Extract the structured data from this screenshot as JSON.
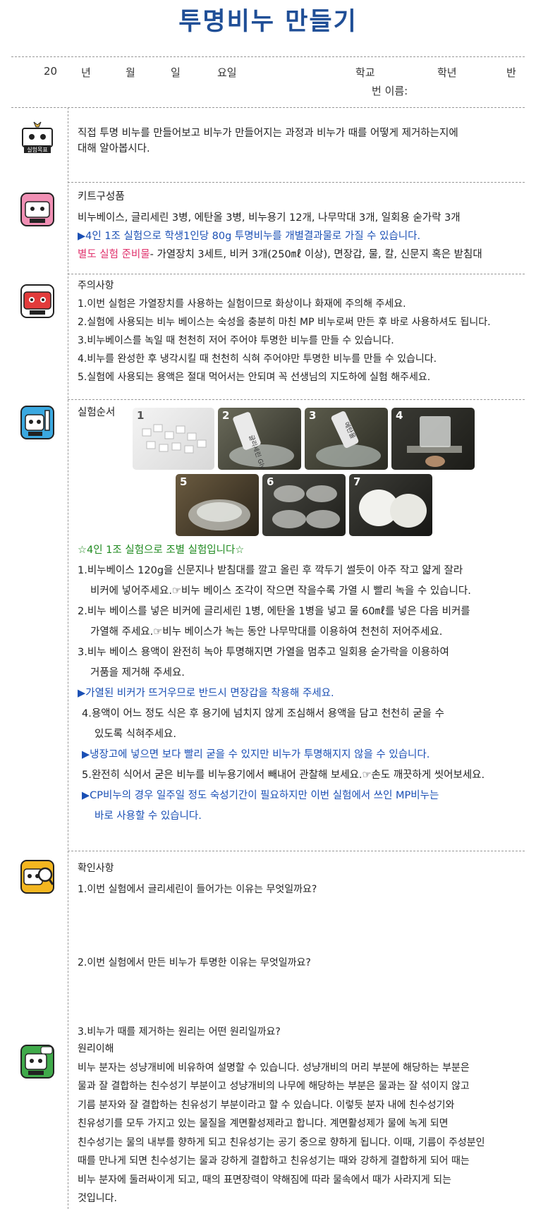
{
  "title": "투명비누 만들기",
  "header": {
    "date": [
      "20",
      "년",
      "월",
      "일",
      "요일"
    ],
    "school": [
      "학교",
      "학년",
      "반"
    ],
    "name": "번 이름:"
  },
  "icons": {
    "goal": "실험목표",
    "kit": "kit-icon",
    "caution": "caution-icon",
    "procedure": "procedure-icon",
    "check": "check-icon",
    "principle": "principle-icon"
  },
  "goal": {
    "text": "직접 투명 비누를 만들어보고 비누가 만들어지는 과정과 비누가 때를 어떻게 제거하는지에",
    "text2": "대해 알아봅시다."
  },
  "kit": {
    "heading": "키트구성품",
    "items": "비누베이스, 글리세린 3병, 에탄올 3병, 비누용기 12개, 나무막대 3개, 일회용 숟가락 3개",
    "note": "▶4인 1조 실험으로 학생1인당 80g 투명비누를 개별결과물로 가질 수 있습니다.",
    "extra_label": "별도 실험 준비물",
    "extra_text": "- 가열장치 3세트, 비커 3개(250㎖ 이상), 면장갑, 물, 칼, 신문지 혹은 받침대"
  },
  "caution": {
    "heading": "주의사항",
    "items": [
      "1.이번 실험은 가열장치를 사용하는 실험이므로 화상이나 화재에 주의해 주세요.",
      "2.실험에 사용되는 비누 베이스는 숙성을 충분히 마친 MP 비누로써 만든 후 바로 사용하셔도 됩니다.",
      "3.비누베이스를 녹일 때 천천히 저어 주어야 투명한 비누를 만들 수 있습니다.",
      "4.비누를 완성한 후 냉각시킬 때 천천히 식혀 주어야만 투명한 비누를 만들 수 있습니다.",
      "5.실험에 사용되는 용액은 절대 먹어서는 안되며 꼭 선생님의 지도하에 실험 해주세요."
    ]
  },
  "procedure": {
    "heading": "실험순서",
    "photo_labels": [
      "1",
      "2",
      "3",
      "4",
      "5",
      "6",
      "7"
    ],
    "photo_text_2": "글리세린 Glycerin",
    "photo_text_3": "에탄올",
    "group_note": "☆4인 1조 실험으로 조별 실험입니다☆",
    "steps": [
      "1.비누베이스 120g을 신문지나 받침대를 깔고 올린 후 깍두기 썰듯이 아주 작고 얇게 잘라",
      "비커에 넣어주세요.☞비누 베이스 조각이 작으면 작을수록 가열 시 빨리 녹을 수 있습니다.",
      "2.비누 베이스를 넣은 비커에 글리세린 1병, 에탄올 1병을 넣고 물 60㎖를 넣은 다음 비커를",
      "가열해 주세요.☞비누 베이스가 녹는 동안 나무막대를 이용하여 천천히 저어주세요.",
      "3.비누 베이스 용액이 완전히 녹아 투명해지면 가열을 멈추고 일회용 숟가락을 이용하여",
      "거품을 제거해 주세요."
    ],
    "warn1": "▶가열된 비커가 뜨거우므로 반드시 면장갑을 착용해 주세요.",
    "steps2": [
      "4.용액이 어느 정도 식은 후 용기에 넘치지 않게 조심해서 용액을 담고 천천히 굳을 수",
      "있도록 식혀주세요."
    ],
    "warn2": "▶냉장고에 넣으면 보다 빨리 굳을 수 있지만 비누가 투명해지지 않을 수 있습니다.",
    "step5": "5.완전히 식어서 굳은 비누를 비누용기에서 빼내어 관찰해 보세요.☞손도 깨끗하게 씻어보세요.",
    "warn3a": "▶CP비누의 경우 일주일 정도 숙성기간이 필요하지만 이번 실험에서 쓰인 MP비누는",
    "warn3b": "바로 사용할 수 있습니다."
  },
  "check": {
    "heading": "확인사항",
    "q1": "1.이번 실험에서 글리세린이 들어가는 이유는 무엇일까요?",
    "q2": "2.이번 실험에서 만든 비누가 투명한 이유는 무엇일까요?",
    "q3": "3.비누가 때를 제거하는 원리는 어떤 원리일까요?"
  },
  "principle": {
    "heading": "원리이해",
    "lines": [
      "비누 분자는 성냥개비에 비유하여 설명할 수 있습니다. 성냥개비의 머리 부분에 해당하는 부분은",
      "물과 잘 결합하는 친수성기 부분이고 성냥개비의 나무에 해당하는 부분은 물과는 잘 섞이지 않고",
      "기름 분자와 잘 결합하는 친유성기 부분이라고 할 수 있습니다. 이렇듯 분자 내에 친수성기와",
      "친유성기를 모두 가지고 있는 물질을 계면활성제라고 합니다. 계면활성제가 물에 녹게 되면",
      "친수성기는 물의 내부를 향하게 되고 친유성기는 공기 중으로 향하게 됩니다. 이때, 기름이 주성분인",
      "때를 만나게 되면 친수성기는 물과 강하게 결합하고 친유성기는 때와 강하게 결합하게 되어 때는",
      "비누 분자에 둘러싸이게 되고, 때의 표면장력이 약해짐에 따라 물속에서 때가 사라지게 되는",
      "것입니다."
    ]
  }
}
